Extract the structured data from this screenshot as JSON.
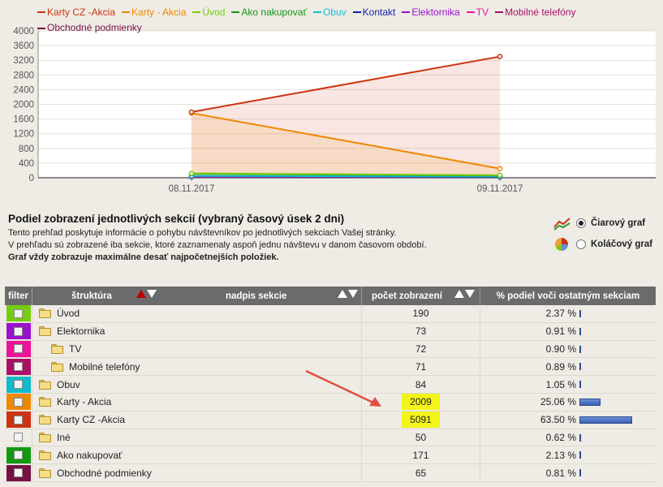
{
  "chart_data": {
    "type": "area",
    "x": [
      "08.11.2017",
      "09.11.2017"
    ],
    "ylim": [
      0,
      4000
    ],
    "yticks": [
      0,
      400,
      800,
      1200,
      1600,
      2000,
      2400,
      2800,
      3200,
      3600,
      4000
    ],
    "series": [
      {
        "name": "Karty CZ -Akcia",
        "color": "#cc3311",
        "values": [
          1790,
          3300
        ]
      },
      {
        "name": "Karty - Akcia",
        "color": "#ee8800",
        "values": [
          1760,
          249
        ]
      },
      {
        "name": "Úvod",
        "color": "#77cc11",
        "values": [
          120,
          70
        ]
      },
      {
        "name": "Ako nakupovať",
        "color": "#119911",
        "values": [
          110,
          61
        ]
      },
      {
        "name": "Obuv",
        "color": "#11bbcc",
        "values": [
          50,
          34
        ]
      },
      {
        "name": "Kontakt",
        "color": "#1122aa",
        "values": [
          30,
          20
        ]
      },
      {
        "name": "Elektornika",
        "color": "#9911cc",
        "values": [
          40,
          33
        ]
      },
      {
        "name": "TV",
        "color": "#ee1199",
        "values": [
          40,
          32
        ]
      },
      {
        "name": "Mobilné telefóny",
        "color": "#aa1166",
        "values": [
          38,
          33
        ]
      },
      {
        "name": "Obchodné podmienky",
        "color": "#771144",
        "values": [
          35,
          30
        ]
      }
    ]
  },
  "summary": {
    "heading": "Podiel zobrazení jednotlivých sekcií (vybraný časový úsek 2 dni)",
    "line1": "Tento prehľad poskytuje informácie o pohybu návštevníkov po jednotlivých sekciach Vašej stránky.",
    "line2": "V prehľadu sú zobrazené iba sekcie, ktoré zaznamenaly aspoň jednu návštevu v danom časovom období.",
    "line3": "Graf vždy zobrazuje maximálne desať najpočetnejších položiek."
  },
  "chart_type": {
    "line_label": "Čiarový graf",
    "pie_label": "Koláčový graf",
    "selected": "line"
  },
  "table": {
    "headers": {
      "filter": "filter",
      "structure": "štruktúra",
      "section_title": "nadpis sekcie",
      "views": "počet zobrazení",
      "share": "% podiel voči ostatným sekciam"
    },
    "rows": [
      {
        "name": "Úvod",
        "color": "#77cc11",
        "indent": 0,
        "views": "190",
        "pct": "2.37 %",
        "share": 2.37,
        "highlight": false
      },
      {
        "name": "Elektornika",
        "color": "#9911cc",
        "indent": 0,
        "views": "73",
        "pct": "0.91 %",
        "share": 0.91,
        "highlight": false
      },
      {
        "name": "TV",
        "color": "#ee1199",
        "indent": 1,
        "views": "72",
        "pct": "0.90 %",
        "share": 0.9,
        "highlight": false
      },
      {
        "name": "Mobilné telefóny",
        "color": "#aa1166",
        "indent": 1,
        "views": "71",
        "pct": "0.89 %",
        "share": 0.89,
        "highlight": false
      },
      {
        "name": "Obuv",
        "color": "#11bbcc",
        "indent": 0,
        "views": "84",
        "pct": "1.05 %",
        "share": 1.05,
        "highlight": false
      },
      {
        "name": "Karty - Akcia",
        "color": "#ee8800",
        "indent": 0,
        "views": "2009",
        "pct": "25.06 %",
        "share": 25.06,
        "highlight": true
      },
      {
        "name": "Karty CZ -Akcia",
        "color": "#cc3311",
        "indent": 0,
        "views": "5091",
        "pct": "63.50 %",
        "share": 63.5,
        "highlight": true
      },
      {
        "name": "Iné",
        "color": "#efece6",
        "indent": 0,
        "views": "50",
        "pct": "0.62 %",
        "share": 0.62,
        "highlight": false
      },
      {
        "name": "Ako nakupovať",
        "color": "#119911",
        "indent": 0,
        "views": "171",
        "pct": "2.13 %",
        "share": 2.13,
        "highlight": false
      },
      {
        "name": "Obchodné podmienky",
        "color": "#771144",
        "indent": 0,
        "views": "65",
        "pct": "0.81 %",
        "share": 0.81,
        "highlight": false
      }
    ]
  }
}
